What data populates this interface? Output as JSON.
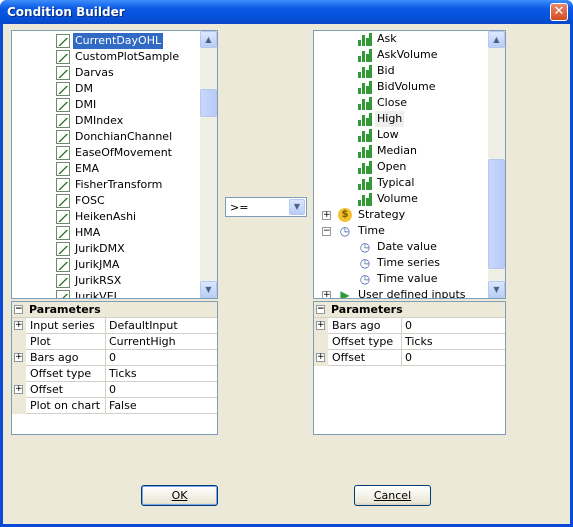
{
  "window": {
    "title": "Condition Builder",
    "close_glyph": "✕"
  },
  "left_tree": {
    "items": [
      {
        "label": "CurrentDayOHL",
        "selected": true
      },
      {
        "label": "CustomPlotSample"
      },
      {
        "label": "Darvas"
      },
      {
        "label": "DM"
      },
      {
        "label": "DMI"
      },
      {
        "label": "DMIndex"
      },
      {
        "label": "DonchianChannel"
      },
      {
        "label": "EaseOfMovement"
      },
      {
        "label": "EMA"
      },
      {
        "label": "FisherTransform"
      },
      {
        "label": "FOSC"
      },
      {
        "label": "HeikenAshi"
      },
      {
        "label": "HMA"
      },
      {
        "label": "JurikDMX"
      },
      {
        "label": "JurikJMA"
      },
      {
        "label": "JurikRSX"
      },
      {
        "label": "JurikVEL"
      }
    ]
  },
  "left_params": {
    "header": "Parameters",
    "rows": [
      {
        "name": "Input series",
        "value": "DefaultInput",
        "expandable": true
      },
      {
        "name": "Plot",
        "value": "CurrentHigh"
      },
      {
        "name": "Bars ago",
        "value": "0",
        "expandable": true
      },
      {
        "name": "Offset type",
        "value": "Ticks"
      },
      {
        "name": "Offset",
        "value": "0",
        "expandable": true
      },
      {
        "name": "Plot on chart",
        "value": "False"
      }
    ]
  },
  "operator": {
    "value": ">="
  },
  "right_tree": {
    "items": [
      {
        "label": "Ask",
        "icon": "bars-icon"
      },
      {
        "label": "AskVolume",
        "icon": "bars-icon"
      },
      {
        "label": "Bid",
        "icon": "bars-icon"
      },
      {
        "label": "BidVolume",
        "icon": "bars-icon"
      },
      {
        "label": "Close",
        "icon": "bars-icon"
      },
      {
        "label": "High",
        "icon": "bars-icon",
        "highlighted": true
      },
      {
        "label": "Low",
        "icon": "bars-icon"
      },
      {
        "label": "Median",
        "icon": "bars-icon"
      },
      {
        "label": "Open",
        "icon": "bars-icon"
      },
      {
        "label": "Typical",
        "icon": "bars-icon"
      },
      {
        "label": "Volume",
        "icon": "bars-icon"
      },
      {
        "label": "Strategy",
        "icon": "coin-icon",
        "toggle": "+"
      },
      {
        "label": "Time",
        "icon": "clock-icon",
        "toggle": "−"
      },
      {
        "label": "Date value",
        "icon": "clock-icon"
      },
      {
        "label": "Time series",
        "icon": "clock-icon"
      },
      {
        "label": "Time value",
        "icon": "clock-icon"
      },
      {
        "label": "User defined inputs",
        "icon": "play-icon",
        "toggle": "+"
      }
    ]
  },
  "right_params": {
    "header": "Parameters",
    "rows": [
      {
        "name": "Bars ago",
        "value": "0",
        "expandable": true
      },
      {
        "name": "Offset type",
        "value": "Ticks"
      },
      {
        "name": "Offset",
        "value": "0",
        "expandable": true
      }
    ]
  },
  "buttons": {
    "ok_label": "OK",
    "cancel_label": "Cancel"
  },
  "colors": {
    "selection": "#316ac5",
    "title_bar": "#0a4ad6",
    "client": "#ece9d8",
    "indicator_green": "#2f9a36"
  }
}
